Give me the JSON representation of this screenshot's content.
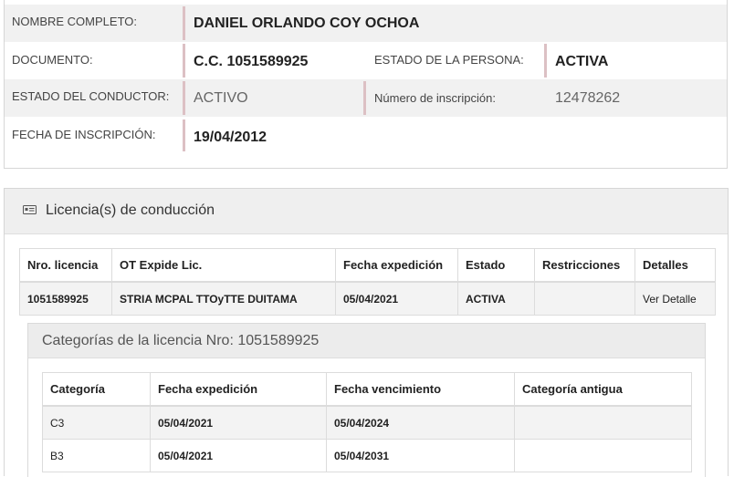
{
  "person": {
    "full_name_label": "NOMBRE COMPLETO:",
    "full_name": "DANIEL ORLANDO COY OCHOA",
    "document_label": "DOCUMENTO:",
    "document": "C.C. 1051589925",
    "person_status_label": "ESTADO DE LA PERSONA:",
    "person_status": "ACTIVA",
    "driver_status_label": "ESTADO DEL CONDUCTOR:",
    "driver_status": "ACTIVO",
    "registration_number_label": "Número de inscripción:",
    "registration_number": "12478262",
    "registration_date_label": "FECHA DE INSCRIPCIÓN:",
    "registration_date": "19/04/2012"
  },
  "licenses": {
    "icon": "id-card-icon",
    "title": "Licencia(s) de conducción",
    "columns": [
      "Nro. licencia",
      "OT Expide Lic.",
      "Fecha expedición",
      "Estado",
      "Restricciones",
      "Detalles"
    ],
    "rows": [
      {
        "number": "1051589925",
        "issuer": "STRIA MCPAL TTOyTTE DUITAMA",
        "issue_date": "05/04/2021",
        "status": "ACTIVA",
        "restrictions": "",
        "details_link": "Ver Detalle"
      }
    ]
  },
  "categories": {
    "title": "Categorías de la licencia Nro: 1051589925",
    "columns": [
      "Categoría",
      "Fecha expedición",
      "Fecha vencimiento",
      "Categoría antigua"
    ],
    "rows": [
      {
        "category": "C3",
        "issue_date": "05/04/2021",
        "expiry_date": "05/04/2024",
        "old_category": ""
      },
      {
        "category": "B3",
        "issue_date": "05/04/2021",
        "expiry_date": "05/04/2031",
        "old_category": ""
      }
    ]
  }
}
